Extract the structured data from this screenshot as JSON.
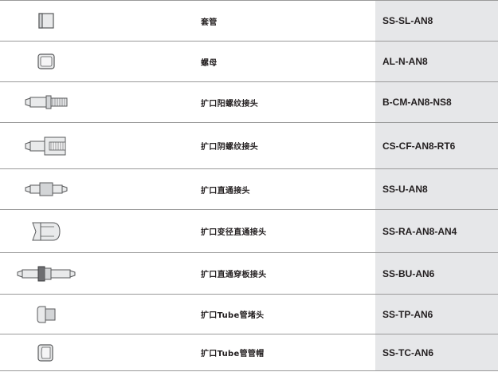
{
  "rows": [
    {
      "icon": "sleeve-icon",
      "name": "套管",
      "code": "SS-SL-AN8"
    },
    {
      "icon": "nut-icon",
      "name": "螺母",
      "code": "AL-N-AN8"
    },
    {
      "icon": "flared-male-connector-icon",
      "name": "扩口阳螺纹接头",
      "code": "B-CM-AN8-NS8"
    },
    {
      "icon": "flared-female-connector-icon",
      "name": "扩口阴螺纹接头",
      "code": "CS-CF-AN8-RT6"
    },
    {
      "icon": "flared-union-icon",
      "name": "扩口直通接头",
      "code": "SS-U-AN8"
    },
    {
      "icon": "flared-reducing-union-icon",
      "name": "扩口变径直通接头",
      "code": "SS-RA-AN8-AN4"
    },
    {
      "icon": "flared-bulkhead-union-icon",
      "name": "扩口直通穿板接头",
      "code": "SS-BU-AN6"
    },
    {
      "icon": "flared-tube-plug-icon",
      "name": "扩口Tube管堵头",
      "code": "SS-TP-AN6"
    },
    {
      "icon": "flared-tube-cap-icon",
      "name": "扩口Tube管管帽",
      "code": "SS-TC-AN6"
    }
  ],
  "colors": {
    "code_background": "#e6e7e9",
    "divider": "#9a9a9a",
    "part_fill": "#e9eaeb",
    "part_stroke": "#58595b"
  }
}
